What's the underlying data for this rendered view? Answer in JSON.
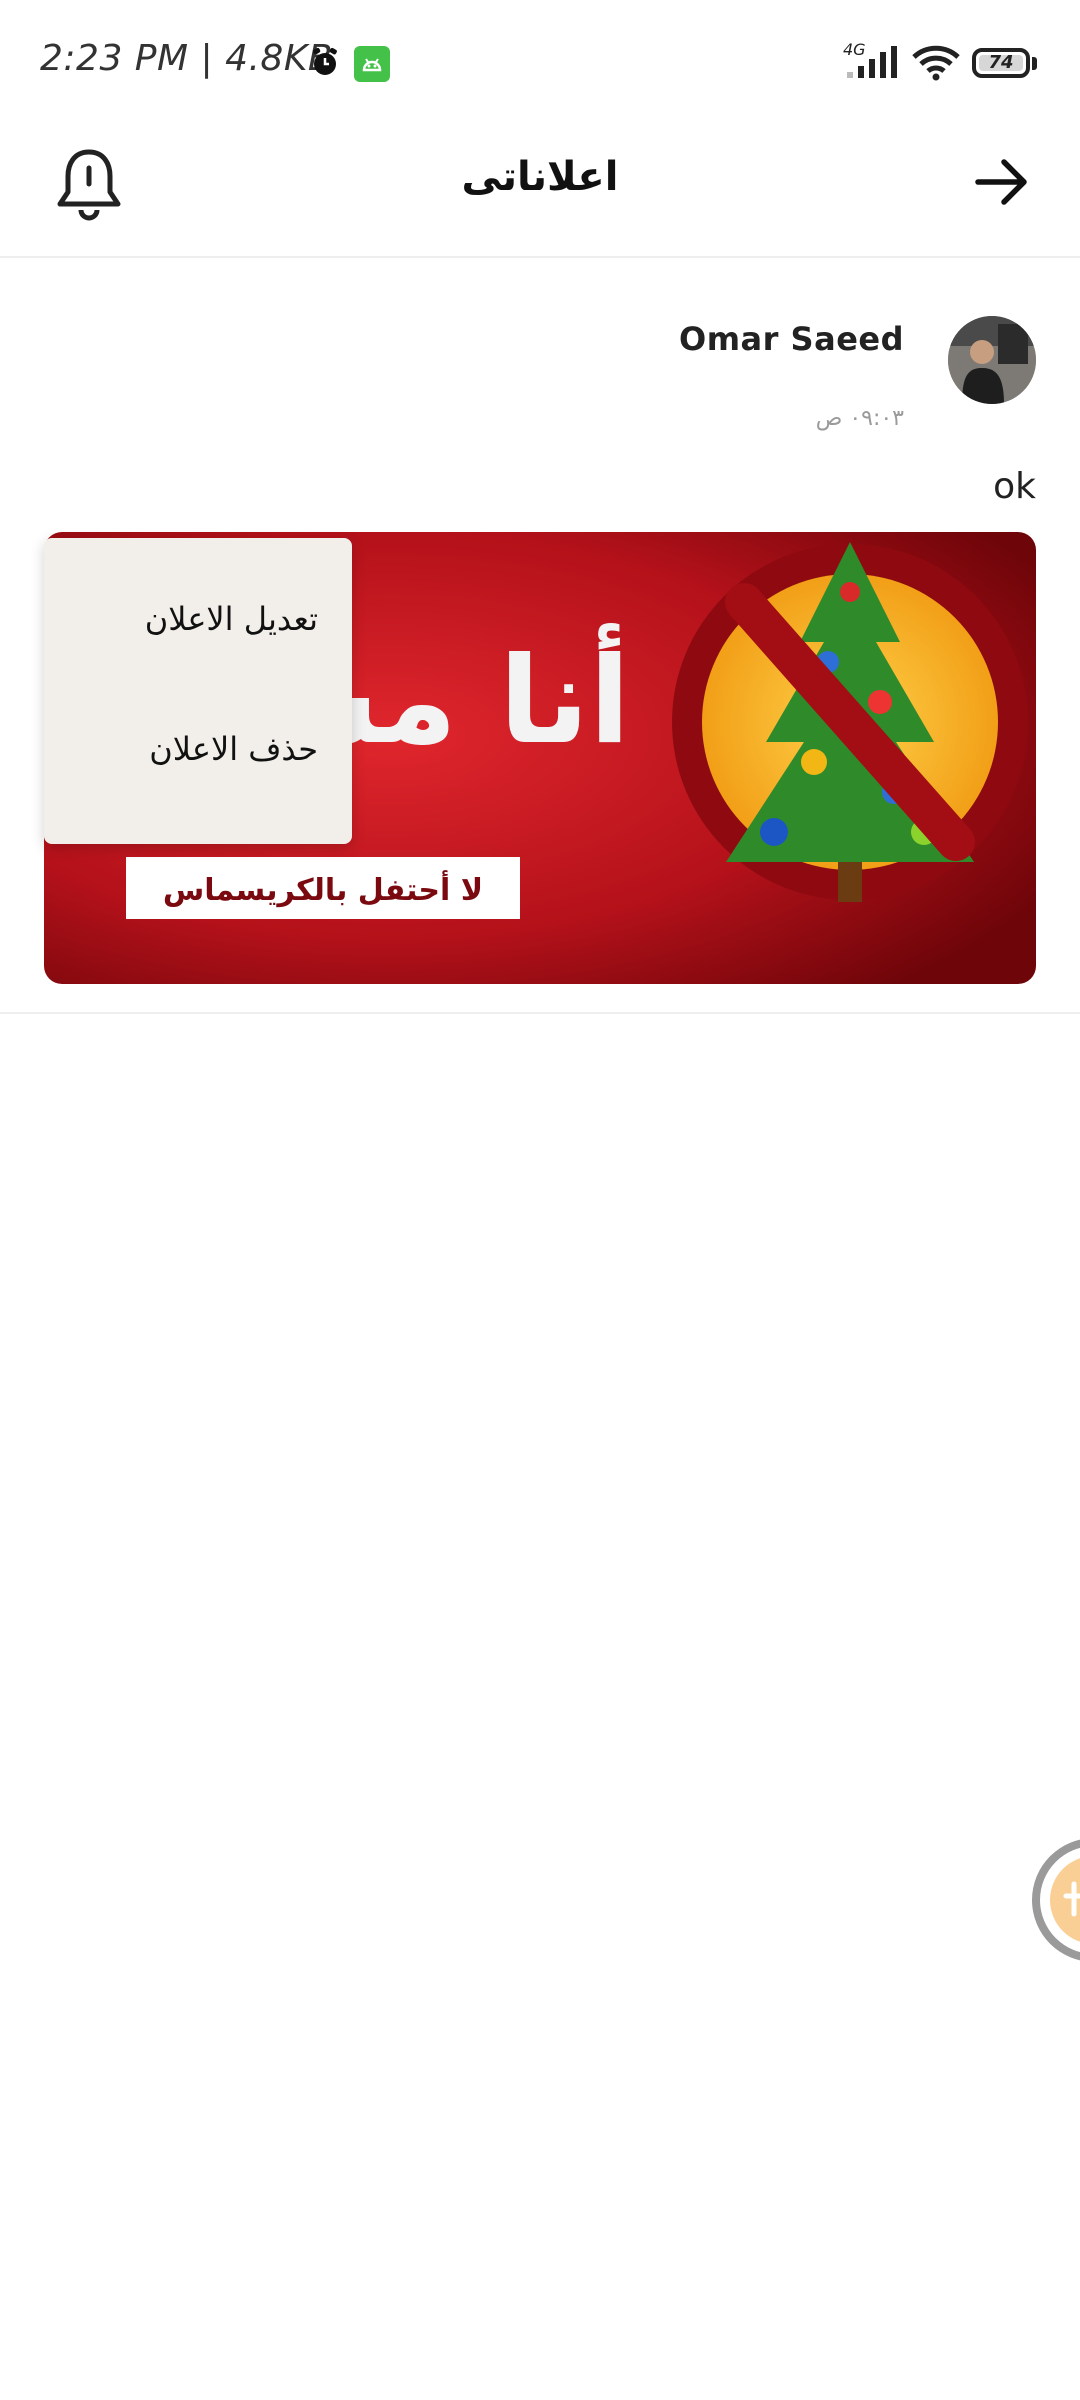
{
  "status_bar": {
    "time_and_speed": "2:23 PM | 4.8KB",
    "network": "4G",
    "battery": "74"
  },
  "header": {
    "title": "اعلاناتى"
  },
  "post": {
    "author": "Omar Saeed",
    "time": "٠٩:٠٣ ص",
    "text": "ok",
    "image": {
      "headline": "أنا مسلم",
      "banner": "لا أحتفل بالكريسماس"
    }
  },
  "menu": {
    "items": [
      {
        "label": "تعديل الاعلان"
      },
      {
        "label": "حذف الاعلان"
      }
    ]
  },
  "icons": [
    "alarm-icon",
    "android-icon",
    "signal-icon",
    "wifi-icon",
    "battery-icon",
    "bell-icon",
    "arrow-right-icon"
  ],
  "colors": {
    "menu_background": "#f2efea",
    "poster_red": "#b4111a",
    "app_badge": "#44c149"
  }
}
